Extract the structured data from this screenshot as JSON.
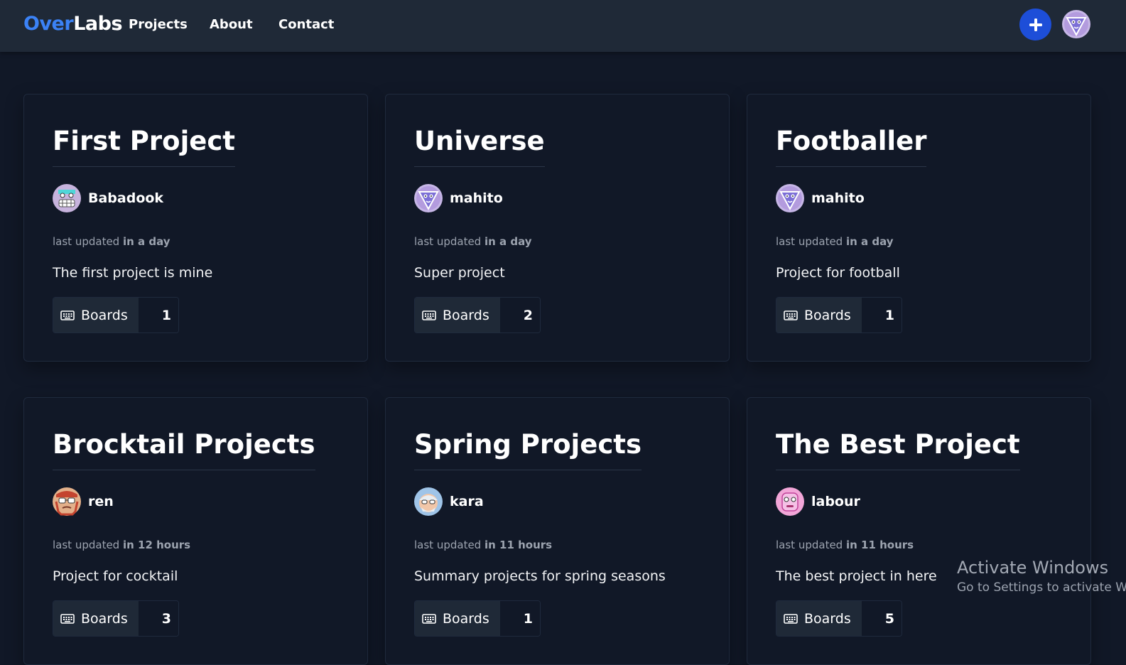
{
  "brand": {
    "part1": "Over",
    "part2": "Labs"
  },
  "nav": {
    "links": [
      "Projects",
      "About",
      "Contact"
    ]
  },
  "header": {
    "add_icon": "plus-icon",
    "user_avatar": "purple-triangle-avatar"
  },
  "projects": [
    {
      "title": "First Project",
      "owner": "Babadook",
      "avatar": "grinning-face-avatar",
      "updated_prefix": "last updated",
      "updated": "in a day",
      "description": "The first project is mine",
      "boards_label": "Boards",
      "boards_count": "1"
    },
    {
      "title": "Universe",
      "owner": "mahito",
      "avatar": "purple-triangle-avatar",
      "updated_prefix": "last updated",
      "updated": "in a day",
      "description": "Super project",
      "boards_label": "Boards",
      "boards_count": "2"
    },
    {
      "title": "Footballer",
      "owner": "mahito",
      "avatar": "purple-triangle-avatar",
      "updated_prefix": "last updated",
      "updated": "in a day",
      "description": "Project for football",
      "boards_label": "Boards",
      "boards_count": "1"
    },
    {
      "title": "Brocktail Projects",
      "owner": "ren",
      "avatar": "glasses-man-avatar",
      "updated_prefix": "last updated",
      "updated": "in 12 hours",
      "description": "Project for cocktail",
      "boards_label": "Boards",
      "boards_count": "3"
    },
    {
      "title": "Spring Projects",
      "owner": "kara",
      "avatar": "old-man-avatar",
      "updated_prefix": "last updated",
      "updated": "in 11 hours",
      "description": "Summary projects for spring seasons",
      "boards_label": "Boards",
      "boards_count": "1"
    },
    {
      "title": "The Best Project",
      "owner": "labour",
      "avatar": "pink-face-avatar",
      "updated_prefix": "last updated",
      "updated": "in 11 hours",
      "description": "The best project in here",
      "boards_label": "Boards",
      "boards_count": "5"
    }
  ],
  "watermark": {
    "line1": "Activate Windows",
    "line2": "Go to Settings to activate W"
  },
  "colors": {
    "background": "#111827",
    "navbar": "#1f2937",
    "accent": "#3b82f6",
    "button": "#1d4ed8"
  }
}
